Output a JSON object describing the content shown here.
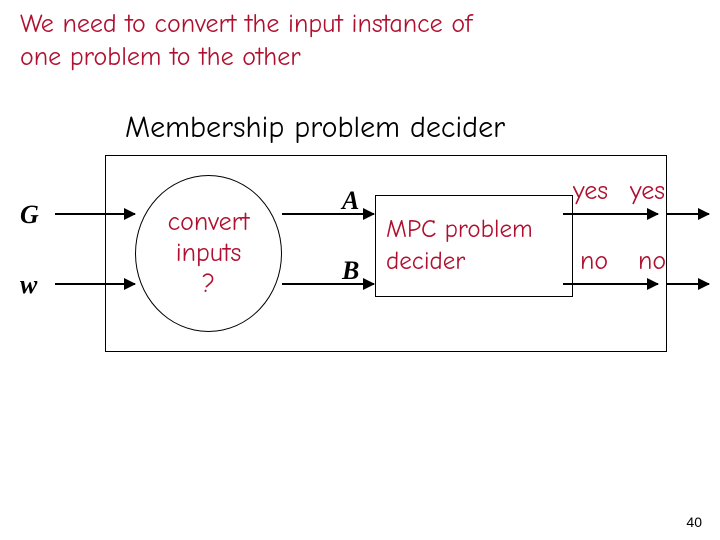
{
  "heading_line1": "We need to convert the input instance of",
  "heading_line2": "one problem to the other",
  "title": "Membership problem decider",
  "inputs": {
    "G": "G",
    "w": "w"
  },
  "converter": {
    "l1": "convert",
    "l2": "inputs",
    "l3": "?"
  },
  "inter": {
    "A": "A",
    "B": "B"
  },
  "inner": {
    "l1": "MPC problem",
    "l2": "decider"
  },
  "outputs": {
    "yes": "yes",
    "no": "no"
  },
  "page_number": "40"
}
